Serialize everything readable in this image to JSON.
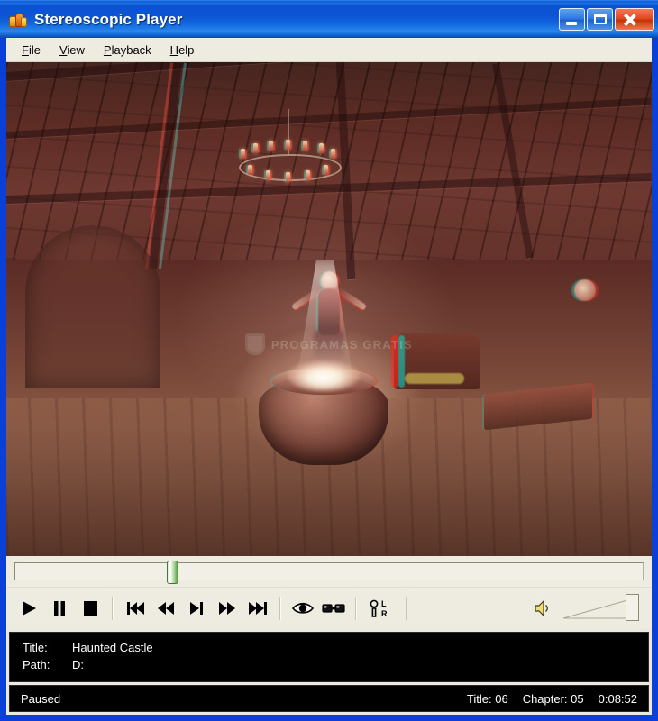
{
  "window": {
    "title": "Stereoscopic Player",
    "icon": "app-icon",
    "controls": {
      "minimize_label": "Minimize",
      "maximize_label": "Maximize",
      "close_label": "Close"
    }
  },
  "menubar": {
    "items": [
      {
        "label": "File",
        "accel": "F",
        "rest": "ile"
      },
      {
        "label": "View",
        "accel": "V",
        "rest": "iew"
      },
      {
        "label": "Playback",
        "accel": "P",
        "rest": "layback"
      },
      {
        "label": "Help",
        "accel": "H",
        "rest": "elp"
      }
    ]
  },
  "video": {
    "scene_description": "Haunted castle interior, red/cyan anaglyph 3D still: vaulted timber ceiling, chandelier, ghost figure with raised arms above a glowing cauldron, armchair and table at right",
    "anaglyph_red": "#ff281e",
    "anaglyph_cyan": "#00e6dc",
    "watermark_text": "PROGRAMAS GRATIS"
  },
  "seek": {
    "position_percent": 25,
    "min": 0,
    "max": 100
  },
  "toolbar": {
    "transport": [
      {
        "name": "play-button",
        "icon": "play-icon",
        "label": "Play"
      },
      {
        "name": "pause-button",
        "icon": "pause-icon",
        "label": "Pause"
      },
      {
        "name": "stop-button",
        "icon": "stop-icon",
        "label": "Stop"
      }
    ],
    "navigation": [
      {
        "name": "skip-back-button",
        "icon": "skip-back-icon",
        "label": "Previous chapter"
      },
      {
        "name": "rewind-button",
        "icon": "rewind-icon",
        "label": "Rewind"
      },
      {
        "name": "step-forward-button",
        "icon": "step-forward-icon",
        "label": "Step forward"
      },
      {
        "name": "fast-forward-button",
        "icon": "fast-forward-icon",
        "label": "Fast forward"
      },
      {
        "name": "skip-forward-button",
        "icon": "skip-forward-icon",
        "label": "Next chapter"
      }
    ],
    "stereo": [
      {
        "name": "viewing-mode-button",
        "icon": "eye-icon",
        "label": "Viewing method"
      },
      {
        "name": "anaglyph-glasses-button",
        "icon": "glasses-icon",
        "label": "Anaglyph glasses"
      }
    ],
    "swap": [
      {
        "name": "swap-left-right-button",
        "icon": "left-right-switch-icon",
        "label": "Swap left/right",
        "top_text": "L",
        "bottom_text": "R"
      }
    ],
    "volume": {
      "speaker_icon": "speaker-icon",
      "speaker_label": "Mute",
      "level_percent": 100
    }
  },
  "info": {
    "rows": [
      {
        "label": "Title:",
        "value": "Haunted Castle"
      },
      {
        "label": "Path:",
        "value": "D:"
      }
    ]
  },
  "status": {
    "state": "Paused",
    "title": "Title: 06",
    "chapter": "Chapter: 05",
    "time": "0:08:52"
  }
}
